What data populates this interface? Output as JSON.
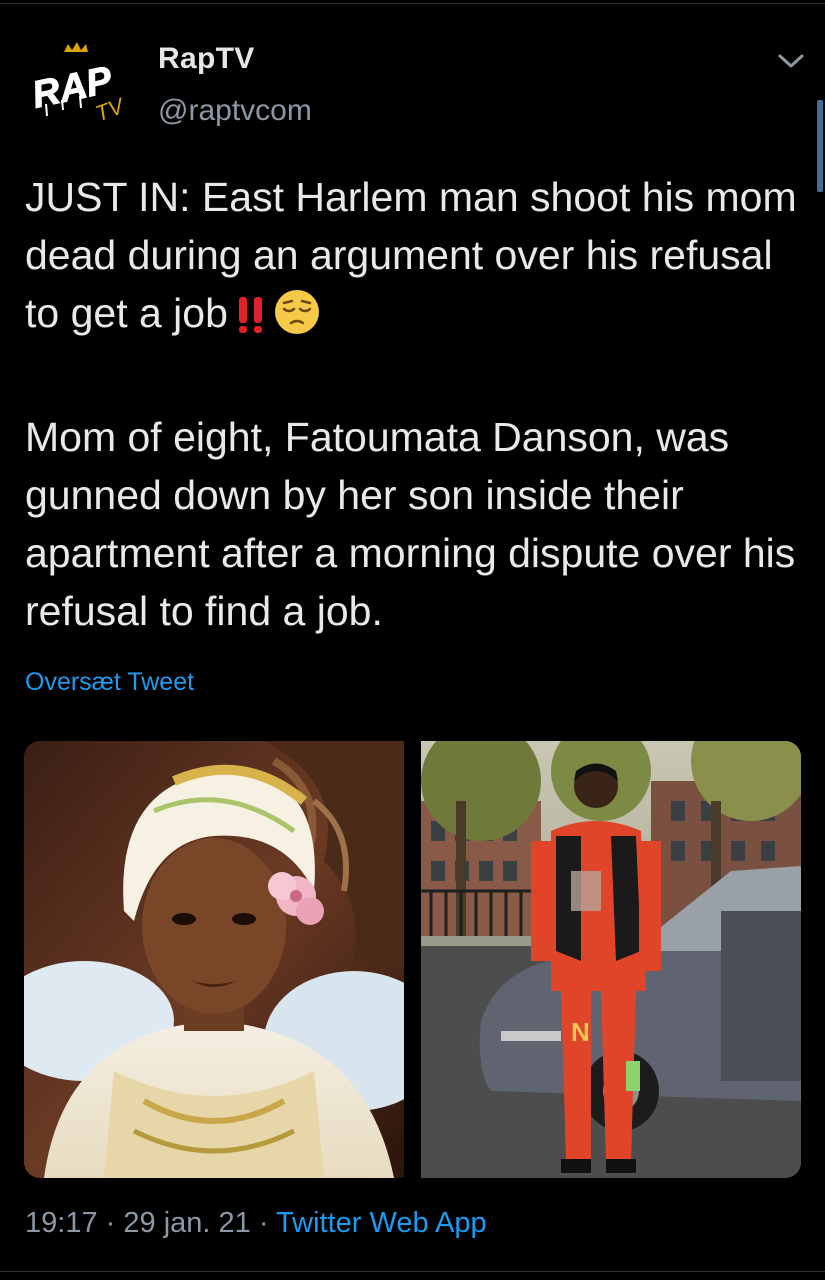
{
  "tweet": {
    "display_name": "RapTV",
    "handle": "@raptvcom",
    "avatar_logo_text": "RAP TV",
    "text_line_1": "JUST IN: East Harlem man shoot his mom dead during an argument over his refusal to get a job",
    "text_paragraph_2": "Mom of eight, Fatoumata Danson, was gunned down by her son inside their apartment after a morning dispute over his refusal to find a job.",
    "emojis": [
      "double-exclamation-icon",
      "pensive-face-icon"
    ],
    "translate_label": "Oversæt Tweet",
    "time": "19:17",
    "separator": "·",
    "date": "29 jan. 21",
    "source": "Twitter Web App"
  },
  "colors": {
    "background": "#000000",
    "text": "#e7e9ea",
    "secondary": "#8b98a5",
    "link": "#1d9bf0",
    "divider": "#2f3336"
  },
  "icons": {
    "more": "chevron-down-icon"
  }
}
